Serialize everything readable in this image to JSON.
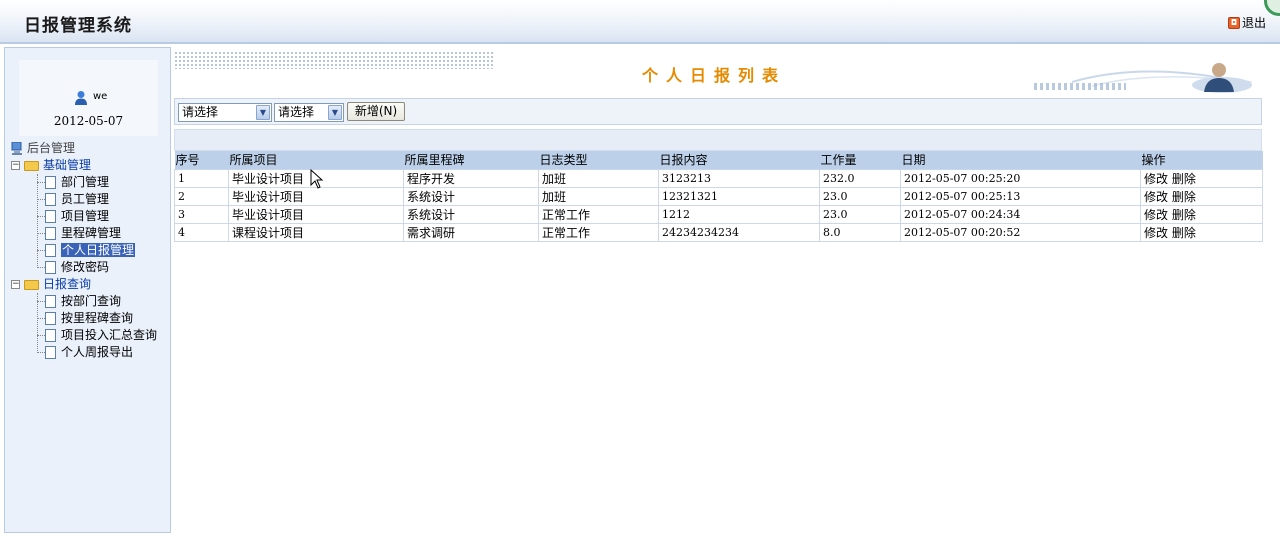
{
  "header": {
    "title": "日报管理系统",
    "logout_label": "退出"
  },
  "user": {
    "name": "we",
    "date": "2012-05-07"
  },
  "tree": {
    "root": "后台管理",
    "groups": [
      {
        "label": "基础管理",
        "items": [
          "部门管理",
          "员工管理",
          "项目管理",
          "里程碑管理",
          "个人日报管理",
          "修改密码"
        ]
      },
      {
        "label": "日报查询",
        "items": [
          "按部门查询",
          "按里程碑查询",
          "项目投入汇总查询",
          "个人周报导出"
        ]
      }
    ],
    "selected": "个人日报管理"
  },
  "page": {
    "title": "个人日报列表"
  },
  "toolbar": {
    "select1_value": "请选择",
    "select2_value": "请选择",
    "add_label": "新增(N)"
  },
  "table": {
    "columns": [
      "序号",
      "所属项目",
      "所属里程碑",
      "日志类型",
      "日报内容",
      "工作量",
      "日期",
      "操作"
    ],
    "rows": [
      {
        "no": "1",
        "project": "毕业设计项目",
        "milestone": "程序开发",
        "type": "加班",
        "content": "3123213",
        "workload": "232.0",
        "date": "2012-05-07 00:25:20",
        "edit": "修改",
        "delete": "删除"
      },
      {
        "no": "2",
        "project": "毕业设计项目",
        "milestone": "系统设计",
        "type": "加班",
        "content": "12321321",
        "workload": "23.0",
        "date": "2012-05-07 00:25:13",
        "edit": "修改",
        "delete": "删除"
      },
      {
        "no": "3",
        "project": "毕业设计项目",
        "milestone": "系统设计",
        "type": "正常工作",
        "content": "1212",
        "workload": "23.0",
        "date": "2012-05-07 00:24:34",
        "edit": "修改",
        "delete": "删除"
      },
      {
        "no": "4",
        "project": "课程设计项目",
        "milestone": "需求调研",
        "type": "正常工作",
        "content": "24234234234",
        "workload": "8.0",
        "date": "2012-05-07 00:20:52",
        "edit": "修改",
        "delete": "删除"
      }
    ]
  },
  "colors": {
    "title_orange": "#e68a00",
    "header_row_blue": "#bcd0ea",
    "selected_item_blue": "#3a63b8"
  }
}
